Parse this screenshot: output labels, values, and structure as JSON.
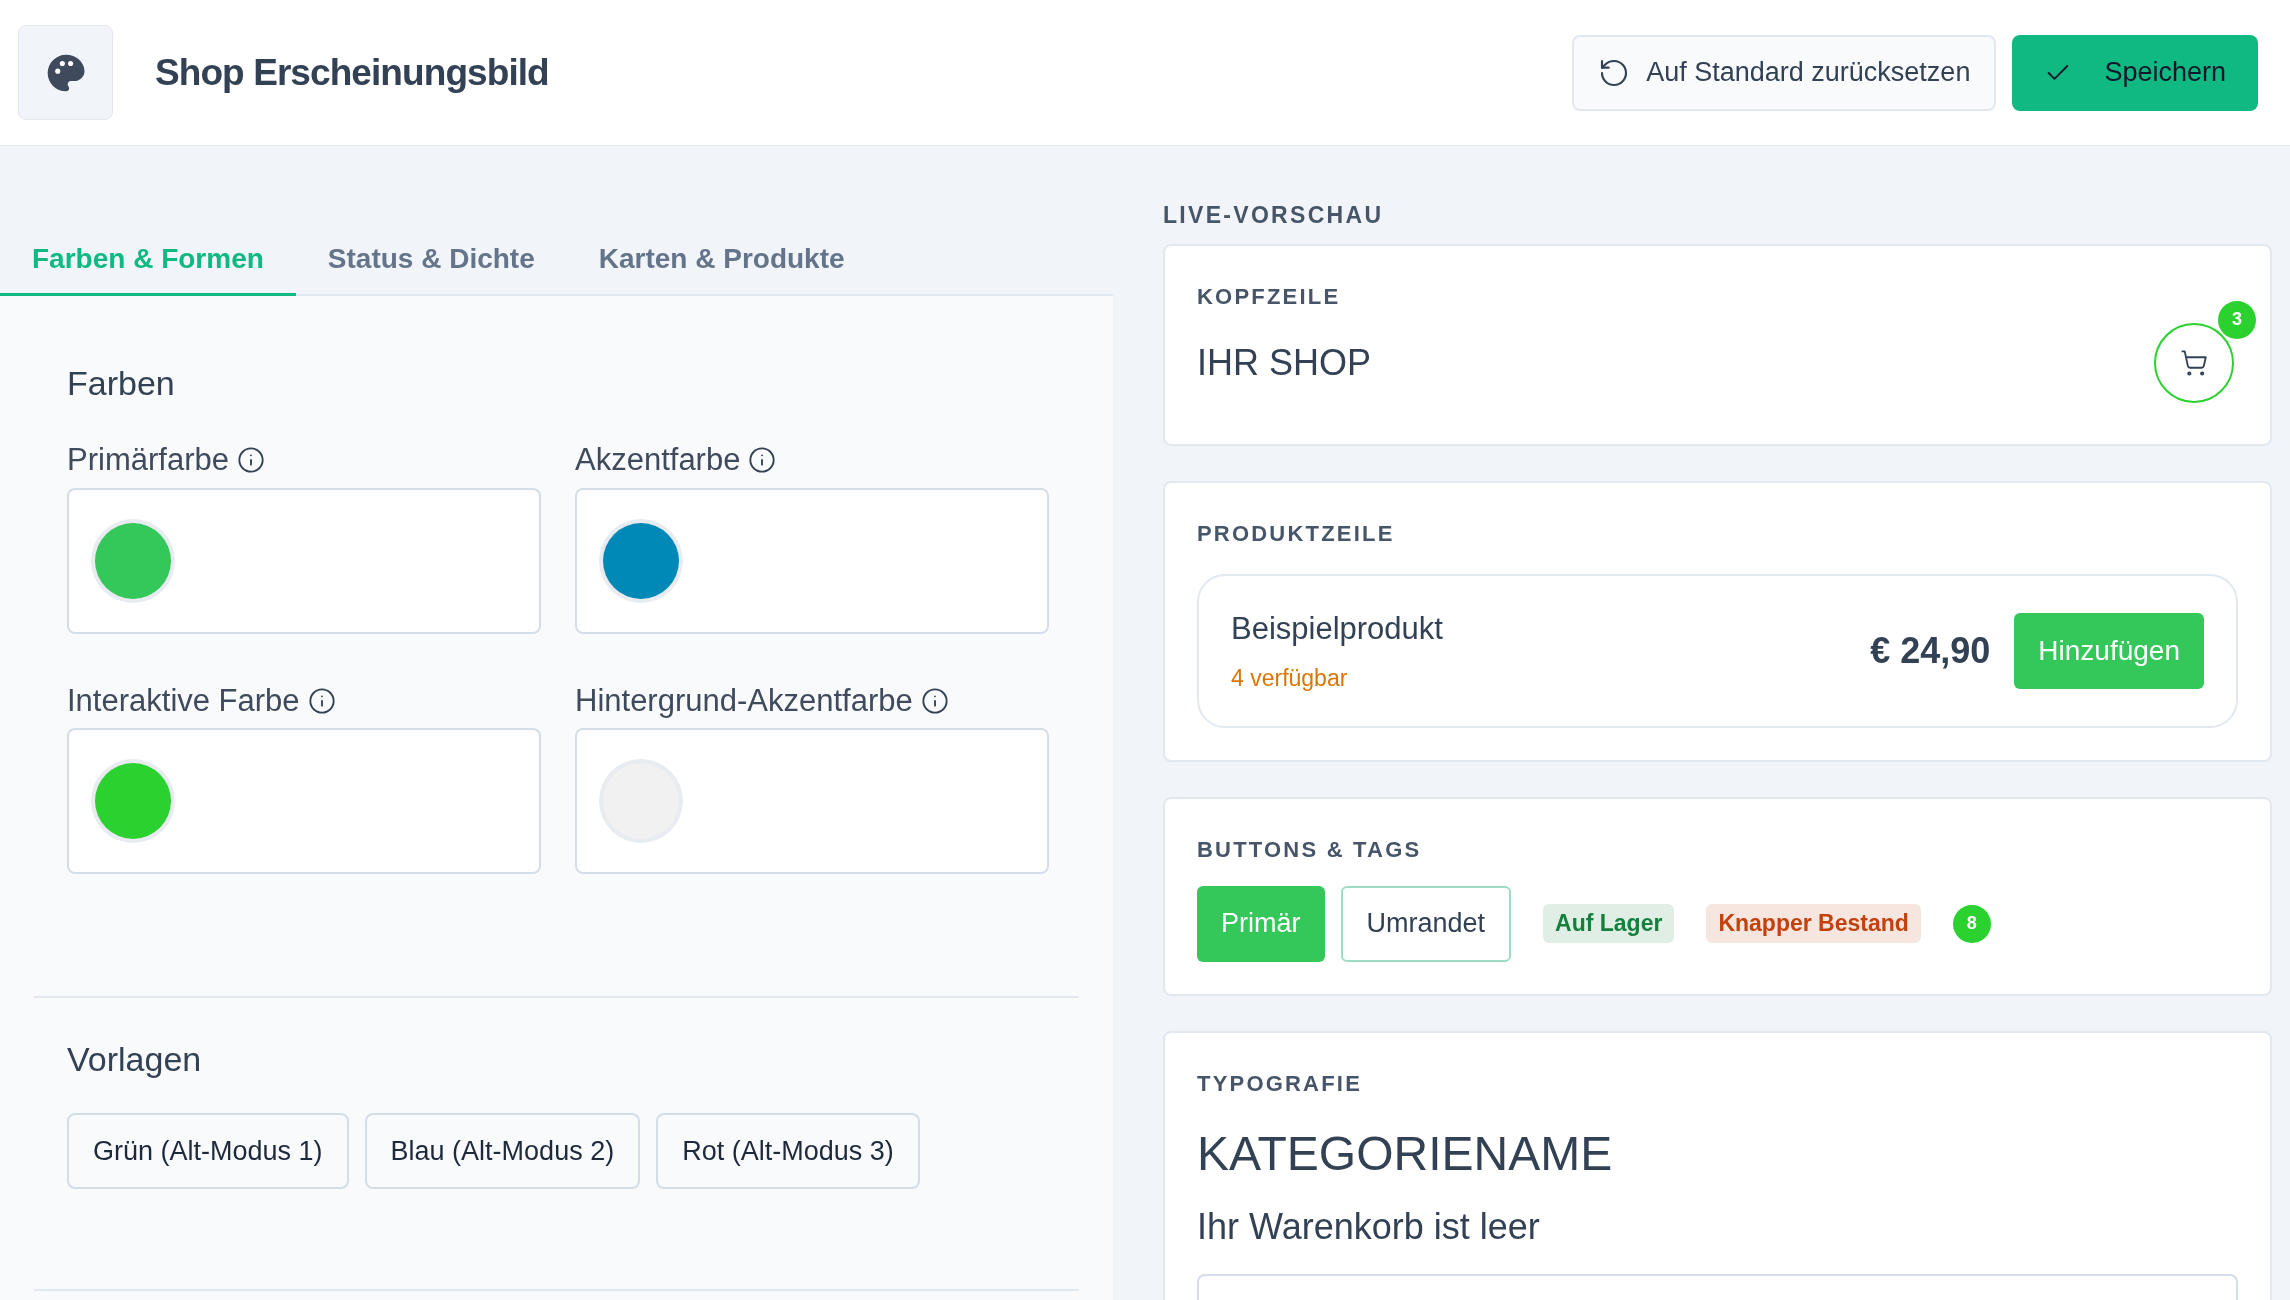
{
  "header": {
    "title": "Shop Erscheinungsbild",
    "reset_button": "Auf Standard zurücksetzen",
    "save_button": "Speichern"
  },
  "tabs": [
    {
      "label": "Farben & Formen",
      "selected": true
    },
    {
      "label": "Status & Dichte",
      "selected": false
    },
    {
      "label": "Karten & Produkte",
      "selected": false
    }
  ],
  "colors_section": {
    "title": "Farben",
    "fields": [
      {
        "label": "Primärfarbe",
        "color": "#34c759"
      },
      {
        "label": "Akzentfarbe",
        "color": "#0088b6"
      },
      {
        "label": "Interaktive Farbe",
        "color": "#2ad12f"
      },
      {
        "label": "Hintergrund-Akzentfarbe",
        "color": "#f1f1f1"
      }
    ]
  },
  "presets_section": {
    "title": "Vorlagen",
    "buttons": [
      "Grün (Alt-Modus 1)",
      "Blau (Alt-Modus 2)",
      "Rot (Alt-Modus 3)"
    ]
  },
  "preview": {
    "title": "LIVE-VORSCHAU",
    "header_card": {
      "title": "KOPFZEILE",
      "shop_name": "IHR SHOP",
      "cart_count": "3"
    },
    "product_card": {
      "title": "PRODUKTZEILE",
      "product_name": "Beispielprodukt",
      "stock": "4 verfügbar",
      "price": "€ 24,90",
      "add_button": "Hinzufügen"
    },
    "buttons_card": {
      "title": "BUTTONS & TAGS",
      "items": [
        {
          "kind": "primary",
          "label": "Primär"
        },
        {
          "kind": "outline",
          "label": "Umrandet"
        },
        {
          "kind": "tag",
          "label": "Auf Lager",
          "color": "#15803d"
        },
        {
          "kind": "tag",
          "label": "Knapper Bestand",
          "color": "#c2410c"
        },
        {
          "kind": "count",
          "label": "8"
        }
      ]
    },
    "typography_card": {
      "title": "TYPOGRAFIE",
      "heading": "KATEGORIENAME",
      "text": "Ihr Warenkorb ist leer"
    }
  }
}
